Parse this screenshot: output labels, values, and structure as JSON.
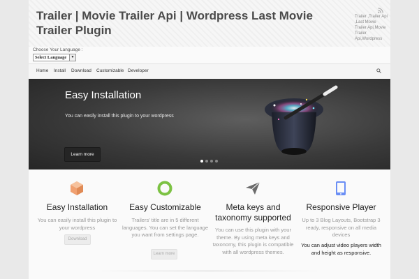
{
  "header": {
    "title": "Trailer | Movie Trailer Api | Wordpress Last Movie Trailer Plugin",
    "tagline": "Trailer ,Trailer Api ,Last Movie Trailer Api,Movie Trailer Api,Wordpress",
    "rss_icon": "rss-icon"
  },
  "language": {
    "label": "Choose Your Language :",
    "selected": "Select Language"
  },
  "nav": {
    "items": [
      "Home",
      "Install",
      "Download",
      "Customizable",
      "Developer"
    ],
    "search_icon": "search-icon"
  },
  "slider": {
    "title": "Easy Installation",
    "text": "You can easily install this plugin to your wordpress",
    "button": "Learn more",
    "slide_count": 4,
    "active_slide": 1
  },
  "features": [
    {
      "icon": "cube-icon",
      "color": "#f0a070",
      "title": "Easy Installation",
      "desc": "You can easily install this plugin to your wordpress",
      "button": "Download"
    },
    {
      "icon": "circle-ring-icon",
      "color": "#7cc243",
      "title": "Easy Customizable",
      "desc": "Trailers' title are in 5 different languages. You can set the language you want from settings page.",
      "button": "Learn more"
    },
    {
      "icon": "paper-plane-icon",
      "color": "#6b6b6b",
      "title": "Meta keys and taxonomy supported",
      "desc": "You can use this plugin with your theme. By using meta keys and taxonomy, this plugin is compatible with all wordpress themes."
    },
    {
      "icon": "tablet-icon",
      "color": "#6a8ef5",
      "title": "Responsive Player",
      "desc": "Up to 3 Blog Layouts, Bootstrap 3 ready, responsive on all media devices",
      "extra": "You can adjust video players width and height as responsive."
    }
  ]
}
